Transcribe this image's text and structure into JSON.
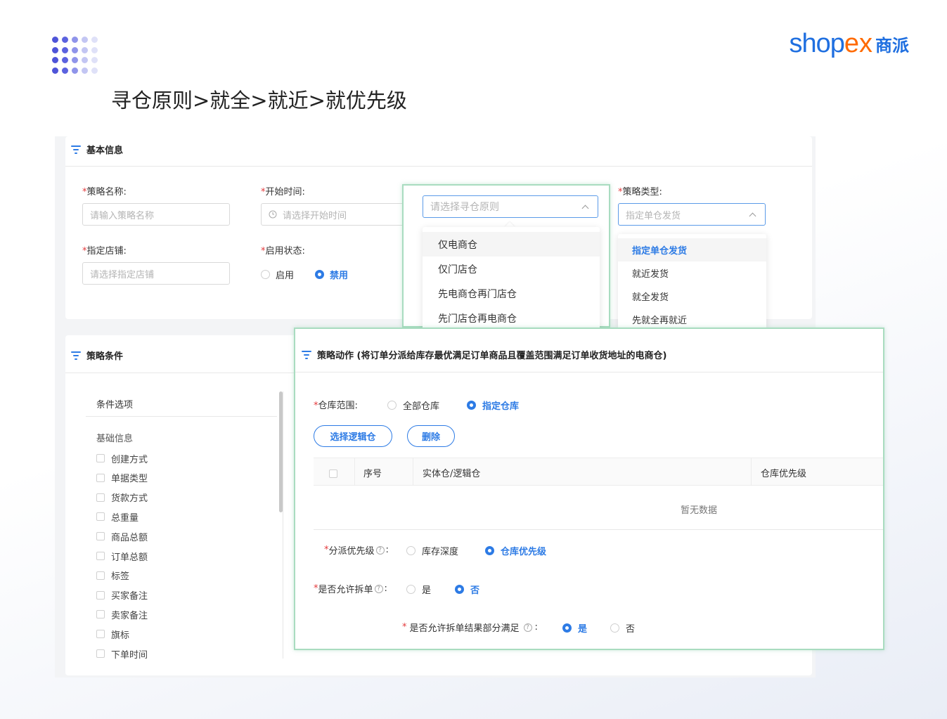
{
  "brand": {
    "logo_shop": "shop",
    "logo_ex": "ex",
    "logo_cn": "商派",
    "primary_color": "#1f6fe0",
    "accent_color": "#ff6a00"
  },
  "heading": "寻仓原则>就全>就近>就优先级",
  "basic": {
    "title": "基本信息",
    "name_label": "策略名称:",
    "name_placeholder": "请输入策略名称",
    "start_label": "开始时间:",
    "start_placeholder": "请选择开始时间",
    "shop_label": "指定店铺:",
    "shop_placeholder": "请选择指定店铺",
    "status_label": "启用状态:",
    "status_options": [
      "启用",
      "禁用"
    ],
    "status_selected": "禁用",
    "principle_placeholder": "请选择寻仓原则",
    "principle_options": [
      "仅电商仓",
      "仅门店仓",
      "先电商仓再门店仓",
      "先门店仓再电商仓"
    ],
    "type_label": "策略类型:",
    "type_value": "指定单仓发货",
    "type_options": [
      "指定单仓发货",
      "就近发货",
      "就全发货",
      "先就全再就近"
    ]
  },
  "conditions": {
    "title": "策略条件",
    "header": "条件选项",
    "group": "基础信息",
    "items": [
      "创建方式",
      "单据类型",
      "货款方式",
      "总重量",
      "商品总额",
      "订单总额",
      "标签",
      "买家备注",
      "卖家备注",
      "旗标",
      "下单时间"
    ]
  },
  "action": {
    "title": "策略动作 (将订单分派给库存最优满足订单商品且覆盖范围满足订单收货地址的电商仓)",
    "range_label": "仓库范围:",
    "range_options": [
      "全部仓库",
      "指定仓库"
    ],
    "range_selected": "指定仓库",
    "btn_select": "选择逻辑仓",
    "btn_delete": "删除",
    "col_index": "序号",
    "col_warehouse": "实体仓/逻辑仓",
    "col_priority": "仓库优先级",
    "empty_text": "暂无数据",
    "dispatch_label": "分派优先级",
    "dispatch_options": [
      "库存深度",
      "仓库优先级"
    ],
    "dispatch_selected": "仓库优先级",
    "split_label": "是否允许拆单",
    "split_options": [
      "是",
      "否"
    ],
    "split_selected": "否",
    "partial_label": "是否允许拆单结果部分满足",
    "partial_options": [
      "是",
      "否"
    ],
    "partial_selected": "是",
    "help_glyph": "?",
    "colon": ":",
    "required_mark": "*"
  }
}
